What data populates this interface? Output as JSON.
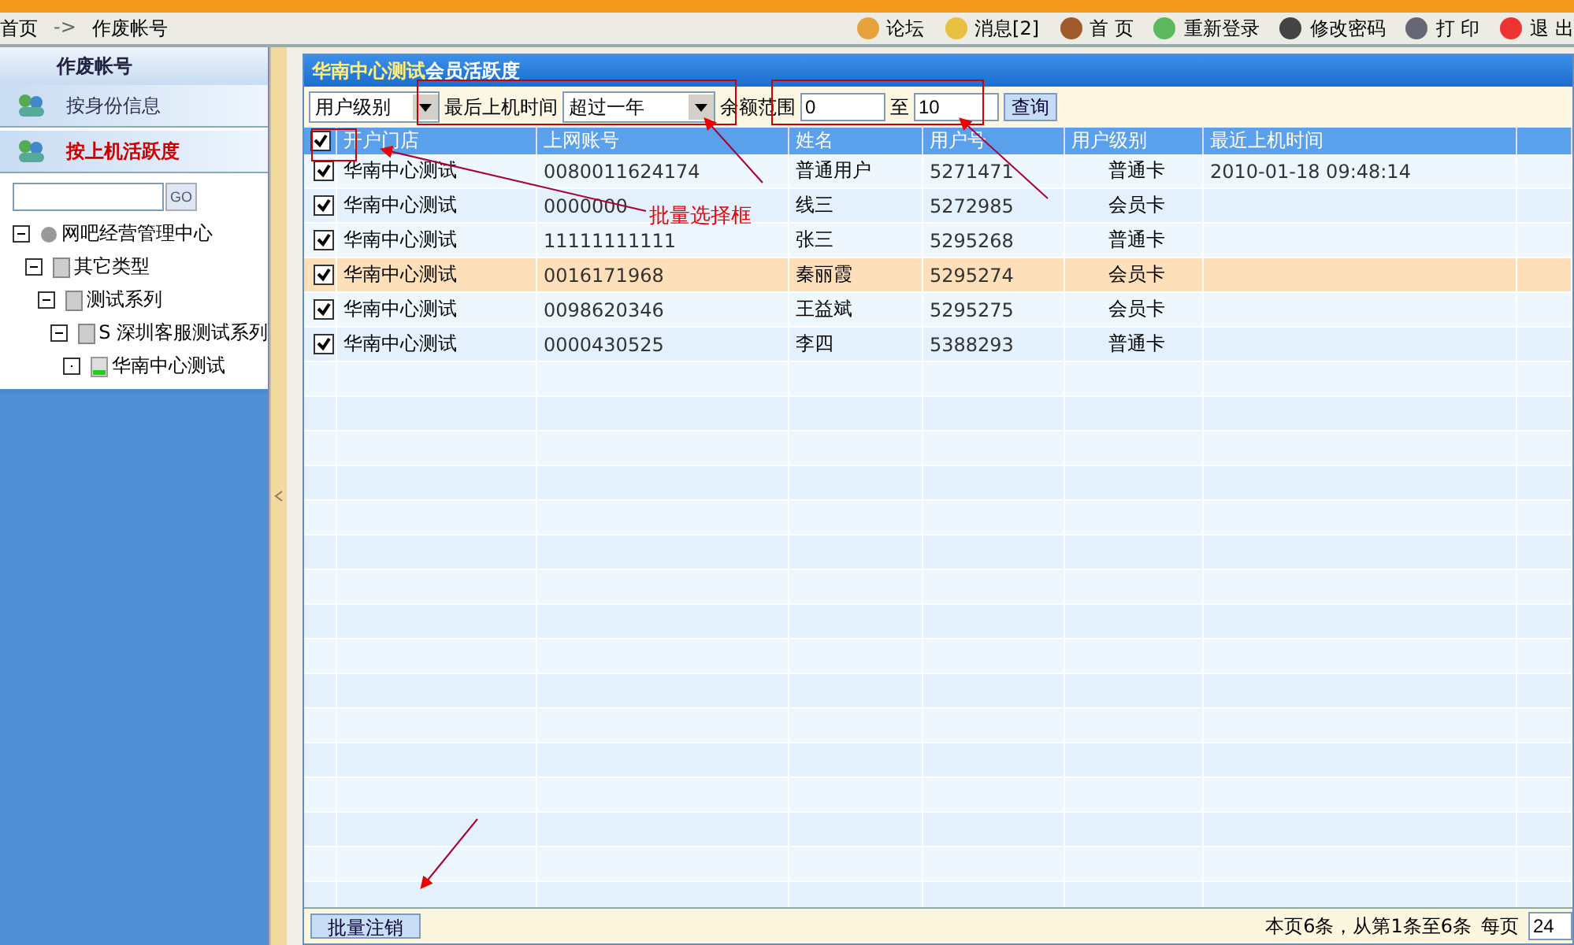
{
  "breadcrumb": {
    "items": [
      "首页",
      "作废帐号"
    ],
    "separator": "->"
  },
  "toolbar": [
    {
      "kind": "forum",
      "label": "论坛"
    },
    {
      "kind": "message",
      "label": "消息[2]"
    },
    {
      "kind": "home",
      "label": "首 页"
    },
    {
      "kind": "relogin",
      "label": "重新登录"
    },
    {
      "kind": "password",
      "label": "修改密码"
    },
    {
      "kind": "print",
      "label": "打 印"
    },
    {
      "kind": "exit",
      "label": "退 出"
    }
  ],
  "sidebar": {
    "header": "作废帐号",
    "items": [
      {
        "label": "按身份信息",
        "selected": false
      },
      {
        "label": "按上机活跃度",
        "selected": true
      }
    ],
    "search": {
      "button": "GO"
    },
    "tree": [
      {
        "label": "网吧经营管理中心",
        "kind": "globe",
        "expanded": true,
        "children": [
          {
            "label": "其它类型",
            "kind": "folder",
            "expanded": true,
            "children": [
              {
                "label": "测试系列",
                "kind": "folder",
                "expanded": true,
                "children": [
                  {
                    "label": "S  深圳客服测试系列",
                    "kind": "folder",
                    "expanded": true,
                    "children": [
                      {
                        "label": "华南中心测试",
                        "kind": "store",
                        "expanded": false
                      }
                    ]
                  }
                ]
              }
            ]
          }
        ]
      }
    ]
  },
  "panel": {
    "title_bold": "华南中心测试",
    "title": "会员活跃度",
    "filters": {
      "level_select": "用户级别",
      "time_label": "最后上机时间",
      "time_select": "超过一年",
      "range_label": "余额范围",
      "range_from": "0",
      "range_to_label": "至",
      "range_to": "10",
      "query_button": "查询"
    },
    "table": {
      "select_all": true,
      "columns": [
        "开户门店",
        "上网账号",
        "姓名",
        "用户号",
        "用户级别",
        "最近上机时间"
      ],
      "rows": [
        {
          "checked": true,
          "selected": false,
          "cells": [
            "华南中心测试",
            "0080011624174",
            "普通用户",
            "5271471",
            "普通卡",
            "2010-01-18 09:48:14"
          ]
        },
        {
          "checked": true,
          "selected": false,
          "cells": [
            "华南中心测试",
            "0000000",
            "线三",
            "5272985",
            "会员卡",
            ""
          ]
        },
        {
          "checked": true,
          "selected": false,
          "cells": [
            "华南中心测试",
            "11111111111",
            "张三",
            "5295268",
            "普通卡",
            ""
          ]
        },
        {
          "checked": true,
          "selected": true,
          "cells": [
            "华南中心测试",
            "0016171968",
            "秦丽霞",
            "5295274",
            "会员卡",
            ""
          ]
        },
        {
          "checked": true,
          "selected": false,
          "cells": [
            "华南中心测试",
            "0098620346",
            "王益斌",
            "5295275",
            "会员卡",
            ""
          ]
        },
        {
          "checked": true,
          "selected": false,
          "cells": [
            "华南中心测试",
            "0000430525",
            "李四",
            "5388293",
            "普通卡",
            ""
          ]
        }
      ]
    },
    "footer": {
      "batch_button": "批量注销",
      "summary": "本页6条，从第1条至6条",
      "per_page_label": "每页",
      "per_page": "24"
    }
  },
  "annotation": {
    "text": "批量选择框"
  }
}
